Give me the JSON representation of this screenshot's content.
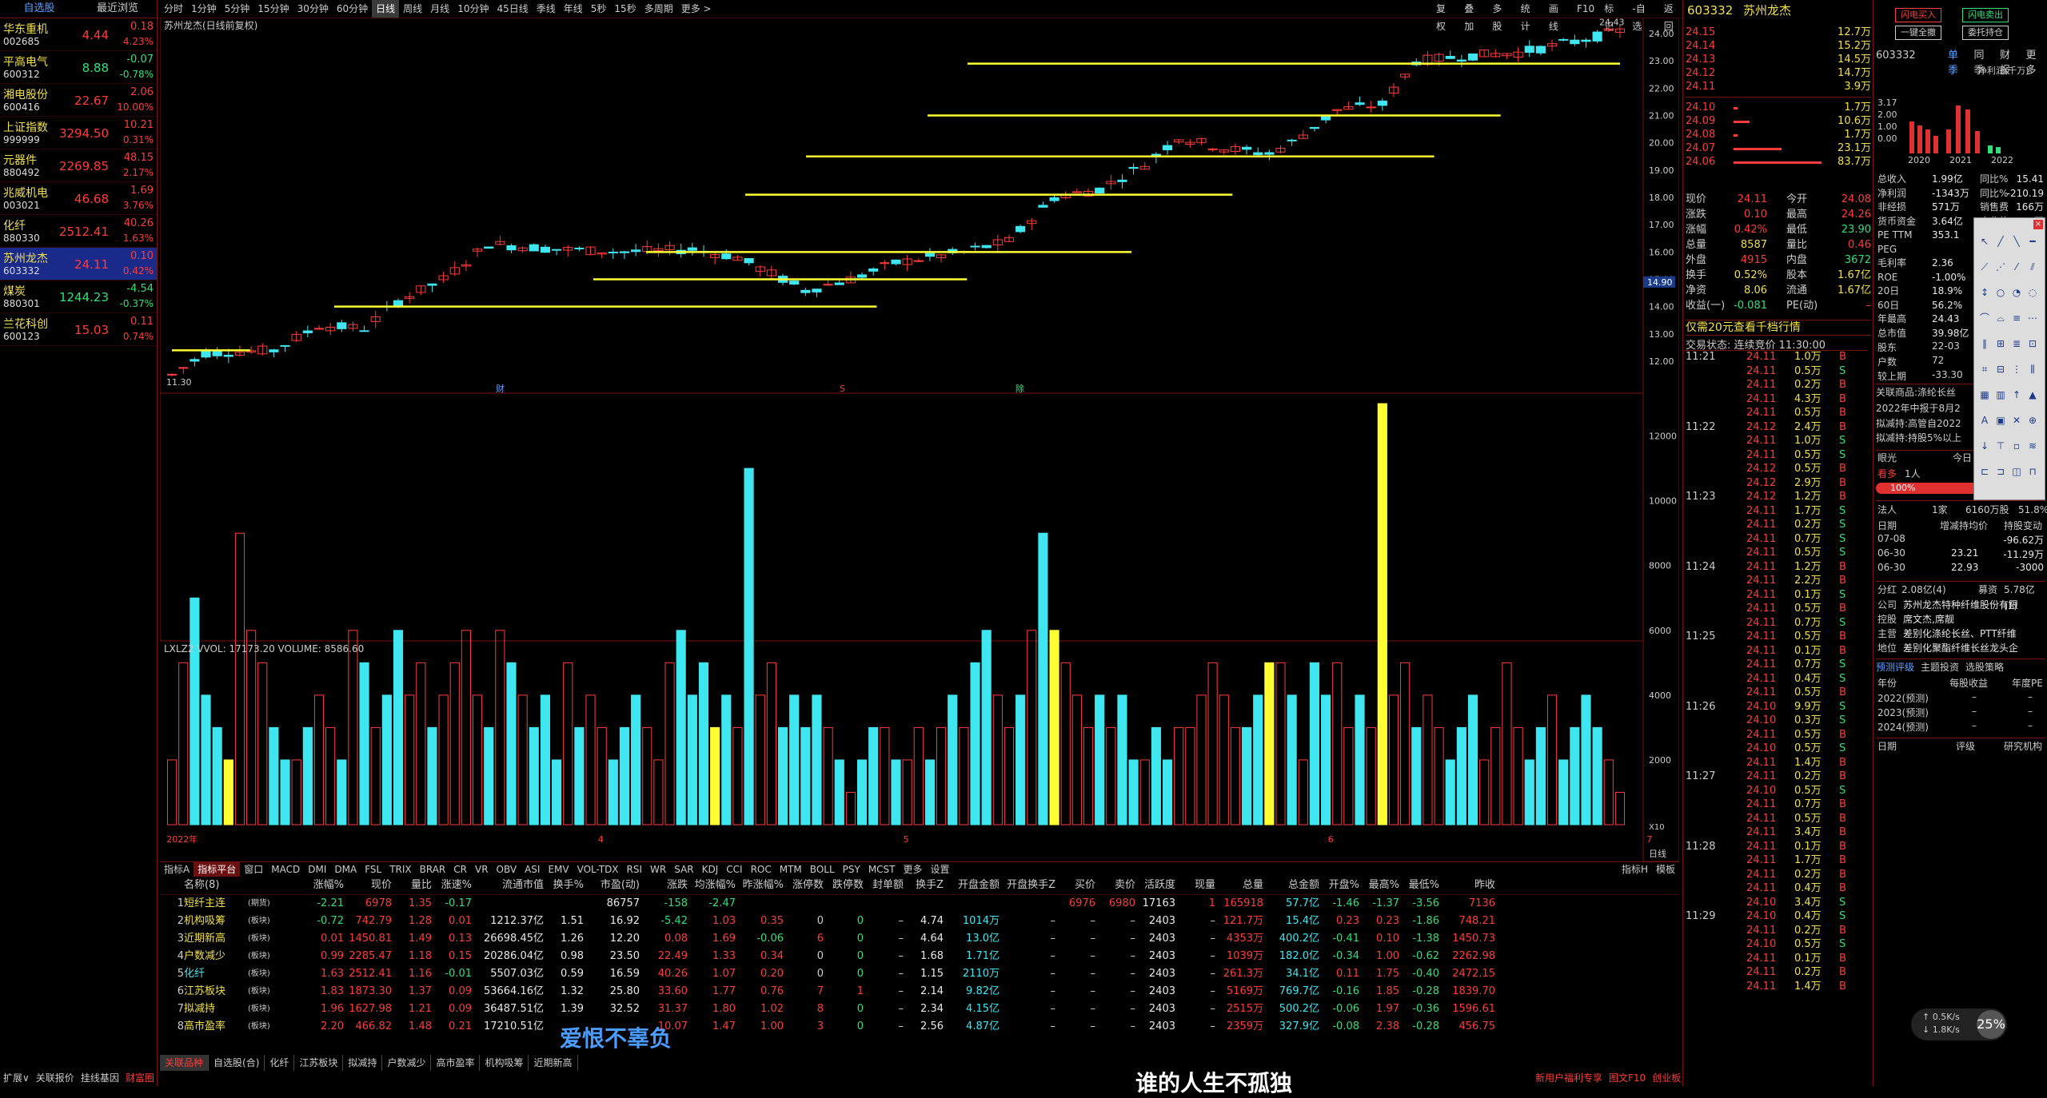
{
  "watchlist": {
    "tabs": [
      "自选股",
      "最近浏览"
    ],
    "items": [
      {
        "name": "华东重机",
        "code": "002685",
        "price": "4.44",
        "change": "0.18",
        "pct": "4.23%",
        "up": true
      },
      {
        "name": "平高电气",
        "code": "600312",
        "price": "8.88",
        "change": "-0.07",
        "pct": "-0.78%",
        "up": false
      },
      {
        "name": "湘电股份",
        "code": "600416",
        "price": "22.67",
        "change": "2.06",
        "pct": "10.00%",
        "up": true
      },
      {
        "name": "上证指数",
        "code": "999999",
        "price": "3294.50",
        "change": "10.21",
        "pct": "0.31%",
        "up": true
      },
      {
        "name": "元器件",
        "code": "880492",
        "price": "2269.85",
        "change": "48.15",
        "pct": "2.17%",
        "up": true
      },
      {
        "name": "兆威机电",
        "code": "003021",
        "price": "46.68",
        "change": "1.69",
        "pct": "3.76%",
        "up": true
      },
      {
        "name": "化纤",
        "code": "880330",
        "price": "2512.41",
        "change": "40.26",
        "pct": "1.63%",
        "up": true
      },
      {
        "name": "苏州龙杰",
        "code": "603332",
        "price": "24.11",
        "change": "0.10",
        "pct": "0.42%",
        "up": true
      },
      {
        "name": "煤炭",
        "code": "880301",
        "price": "1244.23",
        "change": "-4.54",
        "pct": "-0.37%",
        "up": false
      },
      {
        "name": "兰花科创",
        "code": "600123",
        "price": "15.03",
        "change": "0.11",
        "pct": "0.74%",
        "up": true
      }
    ]
  },
  "periodbar": [
    "分时",
    "1分钟",
    "5分钟",
    "15分钟",
    "30分钟",
    "60分钟",
    "日线",
    "周线",
    "月线",
    "10分钟",
    "45日线",
    "季线",
    "年线",
    "5秒",
    "15秒",
    "多周期",
    "更多 >"
  ],
  "active_period": "日线",
  "rightbar": [
    "复权",
    "叠加",
    "多股",
    "统计",
    "画线",
    "F10",
    "标记",
    "-自选",
    "返回"
  ],
  "chart": {
    "title": "苏州龙杰(日线前复权)",
    "price_labels": [
      "24.00",
      "23.00",
      "22.00",
      "21.00",
      "20.00",
      "19.00",
      "18.00",
      "17.00",
      "16.00",
      "15.00",
      "14.00",
      "13.00",
      "12.00"
    ],
    "cursor_price": "14.90",
    "low_label": "11.30",
    "high_label": "24.43",
    "bottom_markers": [
      "财",
      "S",
      "除"
    ],
    "volume_title": "LXLZ2 VVOL: 17173.20  VOLUME: 8586.60",
    "volume_labels": [
      "12000",
      "10000",
      "8000",
      "6000",
      "4000",
      "2000",
      "X10"
    ],
    "month_labels": [
      "2022年",
      "4",
      "5",
      "6",
      "7"
    ],
    "period_tag": "日线"
  },
  "indicator_tabs": [
    "指标A",
    "指标平台",
    "窗口",
    "MACD",
    "DMI",
    "DMA",
    "FSL",
    "TRIX",
    "BRAR",
    "CR",
    "VR",
    "OBV",
    "ASI",
    "EMV",
    "VOL-TDX",
    "RSI",
    "WR",
    "SAR",
    "KDJ",
    "CCI",
    "ROC",
    "MTM",
    "BOLL",
    "PSY",
    "MCST",
    "更多",
    "设置"
  ],
  "indicator_right": [
    "指标H",
    "模板"
  ],
  "table": {
    "headers": [
      "",
      "名称(8)",
      "",
      "涨幅%",
      "现价",
      "量比",
      "涨速%",
      "流通市值",
      "换手%",
      "市盈(动)",
      "涨跌",
      "均涨幅%",
      "昨涨幅%",
      "涨停数",
      "跌停数",
      "封单额",
      "换手Z",
      "开盘金额",
      "开盘换手Z",
      "买价",
      "卖价",
      "活跃度",
      "现量",
      "总量",
      "总金额",
      "开盘%",
      "最高%",
      "最低%",
      "昨收"
    ],
    "rows": [
      [
        "1",
        "短纤主连",
        "(期货)",
        "-2.21",
        "6978",
        "1.35",
        "-0.17",
        "",
        "",
        "86757",
        "-158",
        "-2.47",
        "",
        "",
        "",
        "",
        "",
        "",
        "",
        "6976",
        "6980",
        "17163",
        "1",
        "165918",
        "57.7亿",
        "-1.46",
        "-1.37",
        "-3.56",
        "7136"
      ],
      [
        "2",
        "机构吸筹",
        "(板块)",
        "-0.72",
        "742.79",
        "1.28",
        "0.01",
        "1212.37亿",
        "1.51",
        "16.92",
        "-5.42",
        "1.03",
        "0.35",
        "0",
        "0",
        "–",
        "4.74",
        "1014万",
        "–",
        "–",
        "–",
        "2403",
        "–",
        "121.7万",
        "15.4亿",
        "0.23",
        "0.23",
        "-1.86",
        "748.21"
      ],
      [
        "3",
        "近期新高",
        "(板块)",
        "0.01",
        "1450.81",
        "1.49",
        "0.13",
        "26698.45亿",
        "1.26",
        "12.20",
        "0.08",
        "1.69",
        "-0.06",
        "6",
        "0",
        "–",
        "4.64",
        "13.0亿",
        "–",
        "–",
        "–",
        "2403",
        "–",
        "4353万",
        "400.2亿",
        "-0.41",
        "0.10",
        "-1.38",
        "1450.73"
      ],
      [
        "4",
        "户数减少",
        "(板块)",
        "0.99",
        "2285.47",
        "1.18",
        "0.15",
        "20286.04亿",
        "0.98",
        "23.50",
        "22.49",
        "1.33",
        "0.34",
        "0",
        "0",
        "–",
        "1.68",
        "1.71亿",
        "–",
        "–",
        "–",
        "2403",
        "–",
        "1039万",
        "182.0亿",
        "-0.34",
        "1.00",
        "-0.62",
        "2262.98"
      ],
      [
        "5",
        "化纤",
        "(板块)",
        "1.63",
        "2512.41",
        "1.16",
        "-0.01",
        "5507.03亿",
        "0.59",
        "16.59",
        "40.26",
        "1.07",
        "0.20",
        "0",
        "0",
        "–",
        "1.15",
        "2110万",
        "–",
        "–",
        "–",
        "2403",
        "–",
        "261.3万",
        "34.1亿",
        "0.11",
        "1.75",
        "-0.40",
        "2472.15"
      ],
      [
        "6",
        "江苏板块",
        "(板块)",
        "1.83",
        "1873.30",
        "1.37",
        "0.09",
        "53664.16亿",
        "1.32",
        "25.80",
        "33.60",
        "1.77",
        "0.76",
        "7",
        "1",
        "–",
        "2.14",
        "9.82亿",
        "–",
        "–",
        "–",
        "2403",
        "–",
        "5169万",
        "769.7亿",
        "-0.16",
        "1.85",
        "-0.28",
        "1839.70"
      ],
      [
        "7",
        "拟减持",
        "(板块)",
        "1.96",
        "1627.98",
        "1.21",
        "0.09",
        "36487.51亿",
        "1.39",
        "32.52",
        "31.37",
        "1.80",
        "1.02",
        "8",
        "0",
        "–",
        "2.34",
        "4.15亿",
        "–",
        "–",
        "–",
        "2403",
        "–",
        "2515万",
        "500.2亿",
        "-0.06",
        "1.97",
        "-0.36",
        "1596.61"
      ],
      [
        "8",
        "高市盈率",
        "(板块)",
        "2.20",
        "466.82",
        "1.48",
        "0.21",
        "17210.51亿",
        "",
        "",
        "10.07",
        "1.47",
        "1.00",
        "3",
        "0",
        "–",
        "2.56",
        "4.87亿",
        "–",
        "–",
        "–",
        "2403",
        "–",
        "2359万",
        "327.9亿",
        "-0.08",
        "2.38",
        "-0.28",
        "456.75"
      ]
    ]
  },
  "bottom_tabs": [
    "关联品种",
    "自选股(合)",
    "化纤",
    "江苏板块",
    "拟减持",
    "户数减少",
    "高市盈率",
    "机构吸筹",
    "近期新高"
  ],
  "status_left": [
    "扩展∨",
    "关联报价",
    "挂线基因",
    "财富圈"
  ],
  "status_right": [
    "新用户福利专享",
    "图文F10",
    "创业板"
  ],
  "subtitle_overlay": "爱恨不辜负",
  "subtitle_bottom": "谁的人生不孤独",
  "quote": {
    "code": "603332",
    "name": "苏州龙杰",
    "sells": [
      {
        "p": "24.15",
        "v": "12.7万"
      },
      {
        "p": "24.14",
        "v": "15.2万"
      },
      {
        "p": "24.13",
        "v": "14.5万"
      },
      {
        "p": "24.12",
        "v": "14.7万"
      },
      {
        "p": "24.11",
        "v": "3.9万"
      }
    ],
    "buys": [
      {
        "p": "24.10",
        "v": "1.7万"
      },
      {
        "p": "24.09",
        "v": "10.6万"
      },
      {
        "p": "24.08",
        "v": "1.7万"
      },
      {
        "p": "24.07",
        "v": "23.1万"
      },
      {
        "p": "24.06",
        "v": "83.7万"
      }
    ],
    "stats": [
      [
        "现价",
        "24.11",
        "今开",
        "24.08"
      ],
      [
        "涨跌",
        "0.10",
        "最高",
        "24.26"
      ],
      [
        "涨幅",
        "0.42%",
        "最低",
        "23.90"
      ],
      [
        "总量",
        "8587",
        "量比",
        "0.46"
      ],
      [
        "外盘",
        "4915",
        "内盘",
        "3672"
      ],
      [
        "换手",
        "0.52%",
        "股本",
        "1.67亿"
      ],
      [
        "净资",
        "8.06",
        "流通",
        "1.67亿"
      ],
      [
        "收益(一)",
        "-0.081",
        "PE(动)",
        "–"
      ]
    ],
    "ad": "仅需20元查看千档行情",
    "trade_status": "交易状态: 连续竞价 11:30:00"
  },
  "ticks": {
    "times": [
      "11:21",
      "11:22",
      "11:23",
      "11:24",
      "11:25",
      "11:26",
      "11:27",
      "11:28",
      "11:29"
    ],
    "rows": [
      [
        "24.11",
        "1.0万",
        "B"
      ],
      [
        "24.11",
        "0.5万",
        "S"
      ],
      [
        "24.11",
        "0.2万",
        "B"
      ],
      [
        "24.11",
        "4.3万",
        "B"
      ],
      [
        "24.11",
        "0.5万",
        "B"
      ],
      [
        "24.12",
        "2.4万",
        "B"
      ],
      [
        "24.11",
        "1.0万",
        "S"
      ],
      [
        "24.11",
        "0.5万",
        "S"
      ],
      [
        "24.12",
        "0.5万",
        "B"
      ],
      [
        "24.12",
        "2.9万",
        "B"
      ],
      [
        "24.12",
        "1.2万",
        "B"
      ],
      [
        "24.11",
        "1.7万",
        "S"
      ],
      [
        "24.11",
        "0.2万",
        "S"
      ],
      [
        "24.11",
        "0.7万",
        "S"
      ],
      [
        "24.11",
        "0.5万",
        "S"
      ],
      [
        "24.11",
        "1.2万",
        "B"
      ],
      [
        "24.11",
        "2.2万",
        "B"
      ],
      [
        "24.11",
        "0.1万",
        "S"
      ],
      [
        "24.11",
        "0.5万",
        "B"
      ],
      [
        "24.11",
        "0.7万",
        "S"
      ],
      [
        "24.11",
        "0.5万",
        "B"
      ],
      [
        "24.11",
        "0.1万",
        "B"
      ],
      [
        "24.11",
        "0.7万",
        "S"
      ],
      [
        "24.11",
        "0.4万",
        "S"
      ],
      [
        "24.11",
        "0.5万",
        "B"
      ],
      [
        "24.10",
        "9.9万",
        "S"
      ],
      [
        "24.10",
        "0.3万",
        "S"
      ],
      [
        "24.11",
        "0.5万",
        "B"
      ],
      [
        "24.10",
        "0.5万",
        "S"
      ],
      [
        "24.11",
        "1.4万",
        "B"
      ],
      [
        "24.11",
        "0.2万",
        "B"
      ],
      [
        "24.10",
        "0.5万",
        "S"
      ],
      [
        "24.11",
        "0.7万",
        "B"
      ],
      [
        "24.11",
        "0.5万",
        "B"
      ],
      [
        "24.11",
        "3.4万",
        "B"
      ],
      [
        "24.11",
        "0.1万",
        "B"
      ],
      [
        "24.11",
        "1.7万",
        "B"
      ],
      [
        "24.11",
        "0.2万",
        "B"
      ],
      [
        "24.11",
        "0.4万",
        "B"
      ],
      [
        "24.10",
        "3.4万",
        "S"
      ],
      [
        "24.10",
        "0.4万",
        "S"
      ],
      [
        "24.11",
        "0.2万",
        "B"
      ],
      [
        "24.10",
        "0.5万",
        "S"
      ],
      [
        "24.11",
        "0.1万",
        "B"
      ],
      [
        "24.11",
        "0.2万",
        "B"
      ],
      [
        "24.11",
        "1.4万",
        "B"
      ]
    ]
  },
  "fin": {
    "tabs": [
      "单季",
      "同季",
      "财报",
      "更多"
    ],
    "code": "603332",
    "net_profit_label": "净利润(千万)",
    "bar_ticks": [
      "3.17",
      "2.00",
      "1.00",
      "0.00"
    ],
    "years": [
      "2020",
      "2021",
      "2022"
    ],
    "metrics": [
      [
        "总收入",
        "1.99亿",
        "同比%",
        "15.41"
      ],
      [
        "净利润",
        "-1343万",
        "同比%",
        "-210.19"
      ],
      [
        "非经损",
        "571万",
        "销售费",
        "166万"
      ],
      [
        "货币资金",
        "3.64亿",
        "应收款",
        "165万"
      ],
      [
        "PE TTM",
        "353.1",
        "PB",
        ""
      ],
      [
        "PEG",
        "",
        "",
        "0.30"
      ],
      [
        "毛利率",
        "2.36",
        "净",
        ""
      ],
      [
        "ROE",
        "-1.00%",
        "",
        ""
      ],
      [
        "20日",
        "18.9%",
        "",
        ""
      ],
      [
        "60日",
        "56.2%",
        "",
        ""
      ],
      [
        "年最高",
        "24.43",
        "",
        ""
      ],
      [
        "总市值",
        "39.98亿",
        "",
        ""
      ]
    ],
    "holders": [
      "股东",
      "22-03",
      "户数",
      "72",
      "较上期",
      "-33.30"
    ],
    "related": "关联商品:涤纶长丝",
    "report": "2022年中报于8月2",
    "notes": [
      "拟减持:高管自2022",
      "拟减持:持股5%以上"
    ],
    "vision": {
      "label": "眼光",
      "today": "今日",
      "week": "本周",
      "month": "本月",
      "year": "本年"
    },
    "vision_row": [
      "看多",
      "1人",
      "0人",
      "看空"
    ],
    "bull_pct": "100%",
    "bear_pct": "0%",
    "legal": [
      "法人",
      "1家",
      "6160万股",
      "51.8%"
    ],
    "hold_headers": [
      "日期",
      "增减持均价",
      "持股变动"
    ],
    "hold_rows": [
      [
        "07-08",
        "",
        "-96.62万"
      ],
      [
        "06-30",
        "23.21",
        "-11.29万"
      ],
      [
        "06-30",
        "22.93",
        "-3000"
      ]
    ],
    "dividend": [
      "分红",
      "2.08亿(4)",
      "募资",
      "5.78亿(1)"
    ],
    "company": [
      "公司",
      "苏州龙杰特种纤维股份有限"
    ],
    "control": [
      "控股",
      "席文杰,席靓"
    ],
    "main": [
      "主营",
      "差别化涤纶长丝、PTT纤维"
    ],
    "pos": [
      "地位",
      "差别化聚酯纤维长丝龙头企"
    ],
    "forecast_tabs": [
      "预测评级",
      "主题投资",
      "选股策略"
    ],
    "forecast_headers": [
      "年份",
      "每股收益",
      "年度PE"
    ],
    "forecast_rows": [
      [
        "2022(预测)",
        "–",
        "–"
      ],
      [
        "2023(预测)",
        "–",
        "–"
      ],
      [
        "2024(预测)",
        "–",
        "–"
      ]
    ],
    "rating_headers": [
      "日期",
      "评级",
      "研究机构"
    ]
  },
  "top_right_buttons": [
    "闪电买入",
    "闪电卖出",
    "一键全撤",
    "委托持仓"
  ],
  "net_speed": {
    "up": "0.5K/s",
    "down": "1.8K/s",
    "pct": "25%"
  }
}
